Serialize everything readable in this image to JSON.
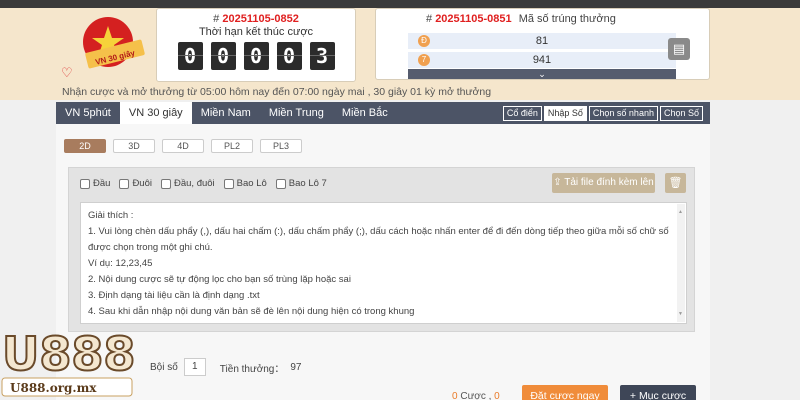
{
  "header": {
    "logo_text": "VN 30 giây",
    "timer": {
      "issue_prefix": "#",
      "issue_number": "20251105-0852",
      "caption": "Thời hạn kết thúc cược",
      "digits": [
        "0",
        "0",
        "0",
        "0",
        "3"
      ]
    },
    "results": {
      "issue_prefix": "#",
      "issue_number": "20251105-0851",
      "title": "Mã số trúng thưởng",
      "rows": [
        {
          "rank": "Đ",
          "value": "81"
        },
        {
          "rank": "7",
          "value": "941"
        }
      ],
      "more": "⌄"
    }
  },
  "notice": "Nhận cược và mở thưởng từ 05:00 hôm nay đến 07:00 ngày mai ,  30 giây 01 kỳ mở thưởng",
  "tabs": [
    "VN 5phút",
    "VN 30 giây",
    "Miền Nam",
    "Miền Trung",
    "Miền Bắc"
  ],
  "active_tab": "VN 30 giây",
  "modes": [
    "Cổ điển",
    "Nhập Số",
    "Chọn số nhanh",
    "Chọn Số"
  ],
  "subtabs": [
    "2D",
    "3D",
    "4D",
    "PL2",
    "PL3"
  ],
  "options": [
    "Đầu",
    "Đuôi",
    "Đầu, đuôi",
    "Bao Lô",
    "Bao Lô 7"
  ],
  "upload_label": "Tải file đính kèm lên",
  "instructions": [
    "Giải thích :",
    "1. Vui lòng chèn dấu phẩy (,), dấu hai chấm (:), dấu chấm phẩy (;), dấu cách hoặc nhấn enter để đi đến dòng tiếp theo giữa mỗi số chữ số được chọn trong một ghi chú.",
    "Ví dụ: 12,23,45",
    "2. Nội dung cược sẽ tự động lọc cho bạn số trùng lặp hoặc sai",
    "3. Định dạng tài liệu cần là định dạng .txt",
    "4. Sau khi dẫn nhập nội dung văn bản sẽ đè lên nội dung hiện có trong khung"
  ],
  "footer": {
    "multiplier_label": "Bội số",
    "multiplier_value": "1",
    "prize_label": "Tiền thưởng：",
    "prize_value": "97",
    "bet_count": "0",
    "bet_unit": "Cược ,",
    "bet_total": "0",
    "bet_now": "Đặt cược ngay",
    "add_bet": "+ Mục cược"
  },
  "watermark": {
    "brand": "U888",
    "domain": "U888.org.mx"
  },
  "colors": {
    "accent_red": "#e02020",
    "orange": "#f08c3a",
    "dark_nav": "#4c5466",
    "tan": "#c7b79a"
  }
}
